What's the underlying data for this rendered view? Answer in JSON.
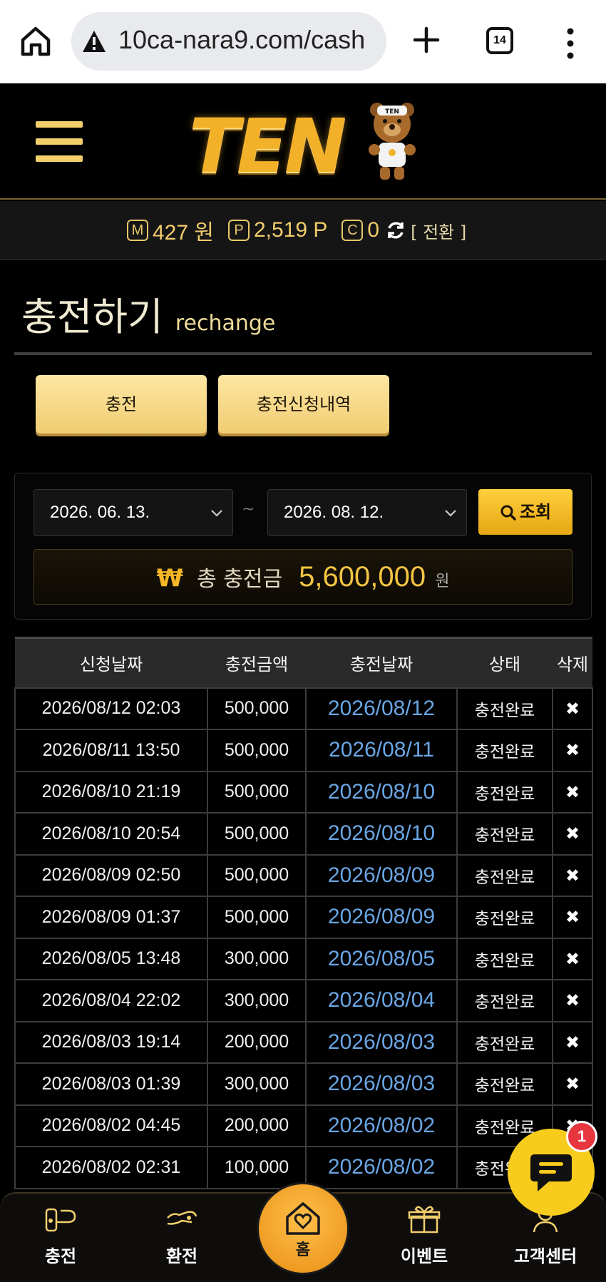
{
  "browser": {
    "url": "10ca-nara9.com/cash",
    "tab_count": "14"
  },
  "header": {
    "logo_text": "TEN",
    "logo_badge": "TEN"
  },
  "balance": {
    "money_icon": "M",
    "money": "427 원",
    "point_icon": "P",
    "point": "2,519 P",
    "coin_icon": "C",
    "coin": "0",
    "swap_label": "[ 전환 ]"
  },
  "page": {
    "title_ko": "충전하기",
    "title_en": "rechange"
  },
  "tabs": {
    "charge": "충전",
    "history": "충전신청내역"
  },
  "filter": {
    "start_date": "2026. 06. 13.",
    "separator": "~",
    "end_date": "2026. 08. 12.",
    "search_label": "조회",
    "won_symbol": "₩",
    "total_label": "총 충전금",
    "total_value": "5,600,000",
    "total_unit": "원"
  },
  "table": {
    "headers": [
      "신청날짜",
      "충전금액",
      "충전날짜",
      "상태",
      "삭제"
    ],
    "rows": [
      {
        "requested": "2026/08/12 02:03",
        "amount": "500,000",
        "charged": "2026/08/12",
        "status": "충전완료",
        "delete": "✖"
      },
      {
        "requested": "2026/08/11 13:50",
        "amount": "500,000",
        "charged": "2026/08/11",
        "status": "충전완료",
        "delete": "✖"
      },
      {
        "requested": "2026/08/10 21:19",
        "amount": "500,000",
        "charged": "2026/08/10",
        "status": "충전완료",
        "delete": "✖"
      },
      {
        "requested": "2026/08/10 20:54",
        "amount": "500,000",
        "charged": "2026/08/10",
        "status": "충전완료",
        "delete": "✖"
      },
      {
        "requested": "2026/08/09 02:50",
        "amount": "500,000",
        "charged": "2026/08/09",
        "status": "충전완료",
        "delete": "✖"
      },
      {
        "requested": "2026/08/09 01:37",
        "amount": "500,000",
        "charged": "2026/08/09",
        "status": "충전완료",
        "delete": "✖"
      },
      {
        "requested": "2026/08/05 13:48",
        "amount": "300,000",
        "charged": "2026/08/05",
        "status": "충전완료",
        "delete": "✖"
      },
      {
        "requested": "2026/08/04 22:02",
        "amount": "300,000",
        "charged": "2026/08/04",
        "status": "충전완료",
        "delete": "✖"
      },
      {
        "requested": "2026/08/03 19:14",
        "amount": "200,000",
        "charged": "2026/08/03",
        "status": "충전완료",
        "delete": "✖"
      },
      {
        "requested": "2026/08/03 01:39",
        "amount": "300,000",
        "charged": "2026/08/03",
        "status": "충전완료",
        "delete": "✖"
      },
      {
        "requested": "2026/08/02 04:45",
        "amount": "200,000",
        "charged": "2026/08/02",
        "status": "충전완료",
        "delete": "✖"
      },
      {
        "requested": "2026/08/02 02:31",
        "amount": "100,000",
        "charged": "2026/08/02",
        "status": "충전완료",
        "delete": "✖"
      }
    ]
  },
  "bottom_nav": {
    "charge": "충전",
    "exchange": "환전",
    "home": "홈",
    "event": "이벤트",
    "support": "고객센터"
  },
  "chat": {
    "badge_count": "1"
  },
  "colors": {
    "accent_gold": "#f2cf6b",
    "link_blue": "#6aa6e4",
    "badge_red": "#e8363f"
  }
}
